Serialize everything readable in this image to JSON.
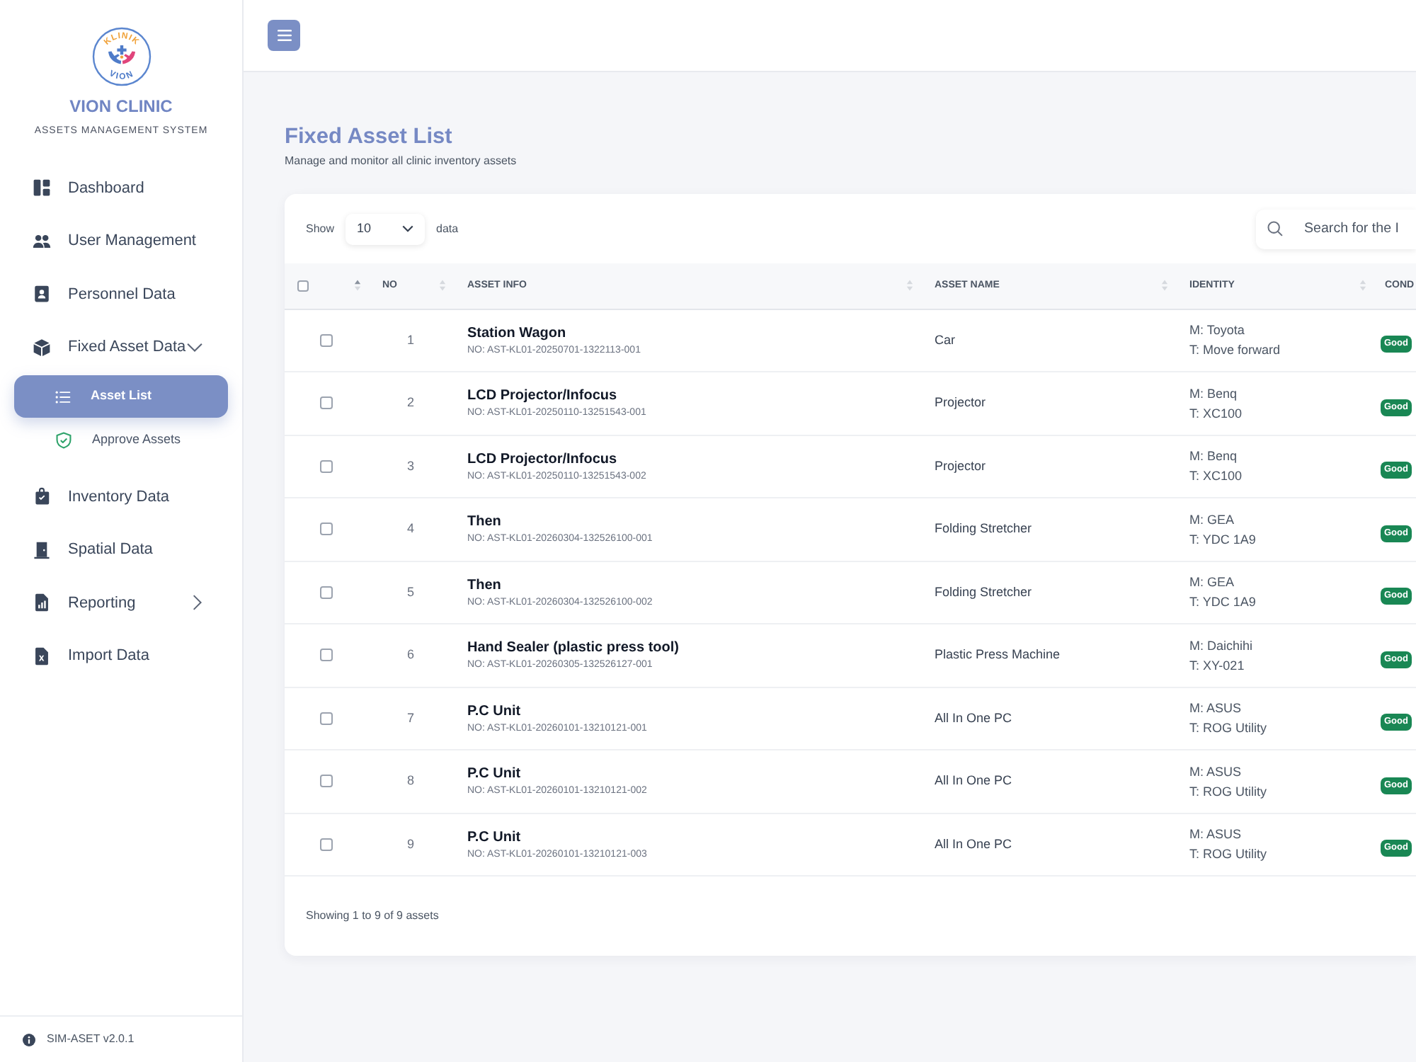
{
  "sidebar": {
    "logo": {
      "top_text": "KLINIK",
      "bottom_text": "VION"
    },
    "brand": "VION CLINIC",
    "tagline": "ASSETS MANAGEMENT SYSTEM",
    "items": [
      {
        "label": "Dashboard",
        "selected": false
      },
      {
        "label": "User Management",
        "selected": false
      },
      {
        "label": "Personnel Data",
        "selected": false
      },
      {
        "label": "Fixed Asset Data",
        "selected": false,
        "expanded": true,
        "children": [
          {
            "label": "Asset List",
            "selected": true
          },
          {
            "label": "Approve Assets",
            "selected": false
          }
        ]
      },
      {
        "label": "Inventory Data",
        "selected": false
      },
      {
        "label": "Spatial Data",
        "selected": false
      },
      {
        "label": "Reporting",
        "selected": false,
        "expanded": false
      },
      {
        "label": "Import Data",
        "selected": false
      }
    ],
    "version": "SIM-ASET v2.0.1"
  },
  "page": {
    "title": "Fixed Asset List",
    "subtitle": "Manage and monitor all clinic inventory assets"
  },
  "table_controls": {
    "show_label": "Show",
    "page_size": "10",
    "page_size_suffix": "data",
    "search": {
      "placeholder": "Search for the I"
    }
  },
  "table": {
    "columns": [
      {
        "kind": "checkbox",
        "checked": false,
        "sorted": true
      },
      {
        "kind": "text",
        "label": "NO",
        "sorted": false
      },
      {
        "kind": "text",
        "label": "ASSET INFO",
        "sorted": false
      },
      {
        "kind": "text",
        "label": "ASSET NAME",
        "sorted": false
      },
      {
        "kind": "text",
        "label": "IDENTITY",
        "sorted": false
      },
      {
        "kind": "text",
        "label": "COND"
      }
    ],
    "rows": [
      {
        "checked": false,
        "no": "1",
        "name": "Station Wagon",
        "code": "NO: AST-KL01-20250701-1322113-001",
        "asset_name": "Car",
        "make": "M: Toyota",
        "type": "T: Move forward",
        "condition": "Good"
      },
      {
        "checked": false,
        "no": "2",
        "name": "LCD Projector/Infocus",
        "code": "NO: AST-KL01-20250110-13251543-001",
        "asset_name": "Projector",
        "make": "M: Benq",
        "type": "T: XC100",
        "condition": "Good"
      },
      {
        "checked": false,
        "no": "3",
        "name": "LCD Projector/Infocus",
        "code": "NO: AST-KL01-20250110-13251543-002",
        "asset_name": "Projector",
        "make": "M: Benq",
        "type": "T: XC100",
        "condition": "Good"
      },
      {
        "checked": false,
        "no": "4",
        "name": "Then",
        "code": "NO: AST-KL01-20260304-132526100-001",
        "asset_name": "Folding Stretcher",
        "make": "M: GEA",
        "type": "T: YDC 1A9",
        "condition": "Good"
      },
      {
        "checked": false,
        "no": "5",
        "name": "Then",
        "code": "NO: AST-KL01-20260304-132526100-002",
        "asset_name": "Folding Stretcher",
        "make": "M: GEA",
        "type": "T: YDC 1A9",
        "condition": "Good"
      },
      {
        "checked": false,
        "no": "6",
        "name": "Hand Sealer (plastic press tool)",
        "code": "NO: AST-KL01-20260305-132526127-001",
        "asset_name": "Plastic Press Machine",
        "make": "M: Daichihi",
        "type": "T: XY-021",
        "condition": "Good"
      },
      {
        "checked": false,
        "no": "7",
        "name": "P.C Unit",
        "code": "NO: AST-KL01-20260101-13210121-001",
        "asset_name": "All In One PC",
        "make": "M: ASUS",
        "type": "T: ROG Utility",
        "condition": "Good"
      },
      {
        "checked": false,
        "no": "8",
        "name": "P.C Unit",
        "code": "NO: AST-KL01-20260101-13210121-002",
        "asset_name": "All In One PC",
        "make": "M: ASUS",
        "type": "T: ROG Utility",
        "condition": "Good"
      },
      {
        "checked": false,
        "no": "9",
        "name": "P.C Unit",
        "code": "NO: AST-KL01-20260101-13210121-003",
        "asset_name": "All In One PC",
        "make": "M: ASUS",
        "type": "T: ROG Utility",
        "condition": "Good"
      }
    ]
  },
  "table_info": "Showing 1 to 9 of 9 assets"
}
